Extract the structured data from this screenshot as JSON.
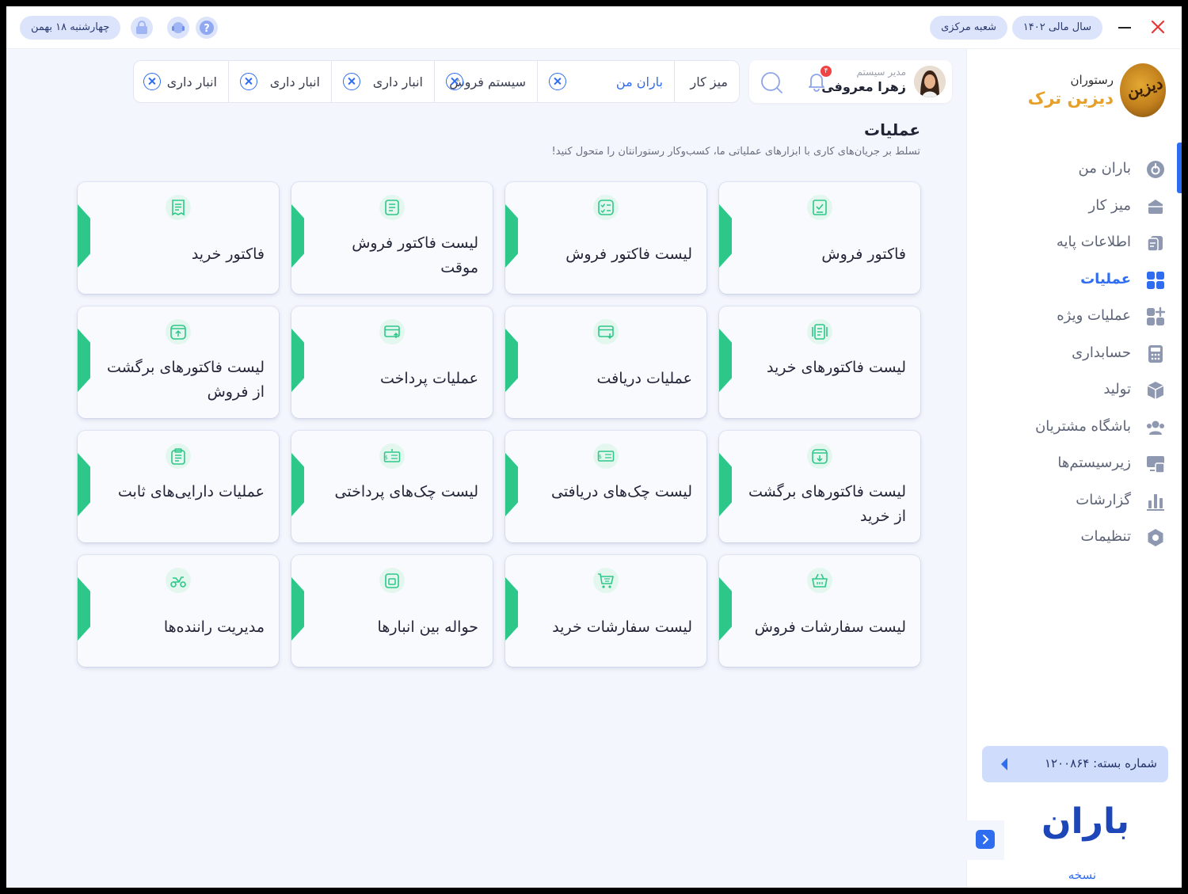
{
  "titlebar": {
    "fiscal_year": "سال مالی ۱۴۰۲",
    "branch": "شعبه مرکزی",
    "date": "چهارشنبه ۱۸ بهمن"
  },
  "brand": {
    "line1": "رستوران",
    "line2": "دیزین ترک",
    "logo_text": "دیزین"
  },
  "sidebar": {
    "items": [
      {
        "label": "باران من",
        "icon": "baran-icon"
      },
      {
        "label": "میز کار",
        "icon": "desk-icon"
      },
      {
        "label": "اطلاعات پایه",
        "icon": "base-info-icon"
      },
      {
        "label": "عملیات",
        "icon": "grid-icon"
      },
      {
        "label": "عملیات ویژه",
        "icon": "grid-plus-icon"
      },
      {
        "label": "حسابداری",
        "icon": "calculator-icon"
      },
      {
        "label": "تولید",
        "icon": "box-icon"
      },
      {
        "label": "باشگاه مشتریان",
        "icon": "users-icon"
      },
      {
        "label": "زیرسیستم‌ها",
        "icon": "subsystems-icon"
      },
      {
        "label": "گزارشات",
        "icon": "chart-icon"
      },
      {
        "label": "تنظیمات",
        "icon": "settings-icon"
      }
    ],
    "active_index": 3,
    "package_label": "شماره بسته: ۱۲۰۰۸۶۴",
    "app_logo": "باران",
    "version_label": "نسخه"
  },
  "user": {
    "role": "مدیر سیستم",
    "name": "زهرا معروفی",
    "notification_count": "۴"
  },
  "tabs": [
    {
      "label": "میز کار",
      "closable": false
    },
    {
      "label": "باران من",
      "closable": true,
      "active": true
    },
    {
      "label": "سیستم فروش",
      "closable": true
    },
    {
      "label": "انبار داری",
      "closable": true
    },
    {
      "label": "انبار داری",
      "closable": true
    },
    {
      "label": "انبار داری",
      "closable": true
    }
  ],
  "page": {
    "title": "عملیات",
    "subtitle": "تسلط بر جریان‌های کاری با ابزارهای عملیاتی ما،  کسب‌وکار رستورانتان را متحول کنید!"
  },
  "cards": [
    {
      "title": "فاکتور فروش",
      "icon": "invoice-check-icon"
    },
    {
      "title": "لیست فاکتور فروش",
      "icon": "list-check-icon"
    },
    {
      "title": "لیست فاکتور فروش موقت",
      "icon": "receipt-list-icon"
    },
    {
      "title": "فاکتور خرید",
      "icon": "receipt-icon"
    },
    {
      "title": "لیست فاکتورهای خرید",
      "icon": "document-list-icon"
    },
    {
      "title": "عملیات دریافت",
      "icon": "card-receive-icon"
    },
    {
      "title": "عملیات پرداخت",
      "icon": "card-send-icon"
    },
    {
      "title": "لیست فاکتورهای برگشت از فروش",
      "icon": "return-up-icon"
    },
    {
      "title": "لیست فاکتورهای برگشت از خرید",
      "icon": "return-down-icon"
    },
    {
      "title": "لیست چک‌های دریافتی",
      "icon": "cheque-icon"
    },
    {
      "title": "لیست چک‌های پرداختی",
      "icon": "cheque-pay-icon"
    },
    {
      "title": "عملیات دارایی‌های ثابت",
      "icon": "clipboard-icon"
    },
    {
      "title": "لیست سفارشات فروش",
      "icon": "basket-icon"
    },
    {
      "title": "لیست سفارشات خرید",
      "icon": "cart-icon"
    },
    {
      "title": "حواله بین انبارها",
      "icon": "warehouse-icon"
    },
    {
      "title": "مدیریت راننده‌ها",
      "icon": "scooter-icon"
    }
  ],
  "colors": {
    "accent": "#2f6df0",
    "card_accent": "#2ec78a",
    "brand_gold": "#e6a02a",
    "close": "#e53935"
  }
}
